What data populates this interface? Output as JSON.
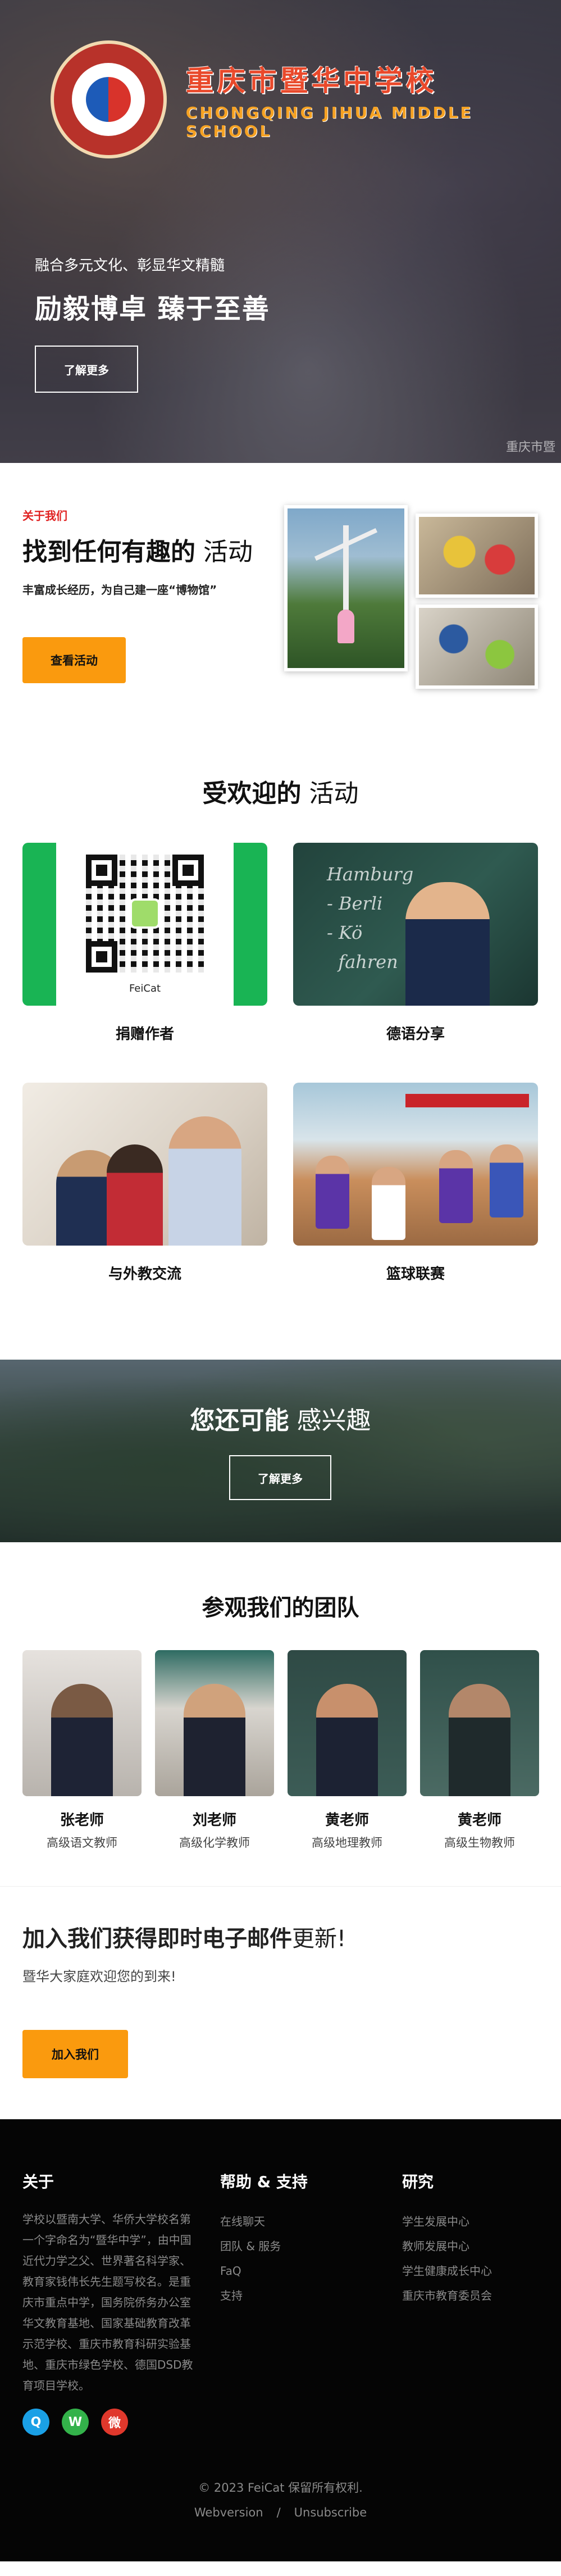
{
  "hero": {
    "school_cn": "重庆市暨华中学校",
    "school_en": "CHONGQING JIHUA MIDDLE SCHOOL",
    "subtitle": "融合多元文化、彰显华文精髓",
    "title": "励毅博卓 臻于至善",
    "button": "了解更多",
    "watermark": "重庆市暨"
  },
  "about": {
    "kicker": "关于我们",
    "title_bold": "找到任何有趣的",
    "title_rest": " 活动",
    "desc": "丰富成长经历，为自己建一座“博物馆”",
    "button": "查看活动"
  },
  "popular": {
    "title_bold": "受欢迎的",
    "title_rest": " 活动",
    "cards": [
      {
        "label": "捐赠作者",
        "caption": "FeiCat"
      },
      {
        "label": "德语分享",
        "board": "Hamburg\n- Berli\n- Kö\n  fahren"
      },
      {
        "label": "与外教交流"
      },
      {
        "label": "篮球联赛"
      }
    ]
  },
  "interest": {
    "title_bold": "您还可能",
    "title_rest": " 感兴趣",
    "button": "了解更多"
  },
  "team": {
    "title": "参观我们的团队",
    "members": [
      {
        "name": "张老师",
        "role": "高级语文教师"
      },
      {
        "name": "刘老师",
        "role": "高级化学教师"
      },
      {
        "name": "黄老师",
        "role": "高级地理教师"
      },
      {
        "name": "黄老师",
        "role": "高级生物教师"
      }
    ]
  },
  "newsletter": {
    "title_bold": "加入我们获得即时电子邮件",
    "title_rest": "更新!",
    "desc": "暨华大家庭欢迎您的到来!",
    "button": "加入我们"
  },
  "footer": {
    "about_head": "关于",
    "about_text": "学校以暨南大学、华侨大学校名第一个字命名为“暨华中学”，由中国近代力学之父、世界著名科学家、教育家钱伟长先生题写校名。是重庆市重点中学，国务院侨务办公室华文教育基地、国家基础教育改革示范学校、重庆市教育科研实验基地、重庆市绿色学校、德国DSD教育项目学校。",
    "help_head": "帮助 & 支持",
    "help_links": [
      "在线聊天",
      "团队 & 服务",
      "FaQ",
      "支持"
    ],
    "research_head": "研究",
    "research_links": [
      "学生发展中心",
      "教师发展中心",
      "学生健康成长中心",
      "重庆市教育委员会"
    ],
    "socials": [
      {
        "icon": "qq-icon",
        "glyph": "Q",
        "color": "#1aa0e6"
      },
      {
        "icon": "wechat-icon",
        "glyph": "W",
        "color": "#33b24a"
      },
      {
        "icon": "weibo-icon",
        "glyph": "微",
        "color": "#e0382c"
      }
    ],
    "copyright": "© 2023 FeiCat 保留所有权利.",
    "link_web": "Webversion",
    "link_sep": "/",
    "link_unsub": "Unsubscribe"
  }
}
